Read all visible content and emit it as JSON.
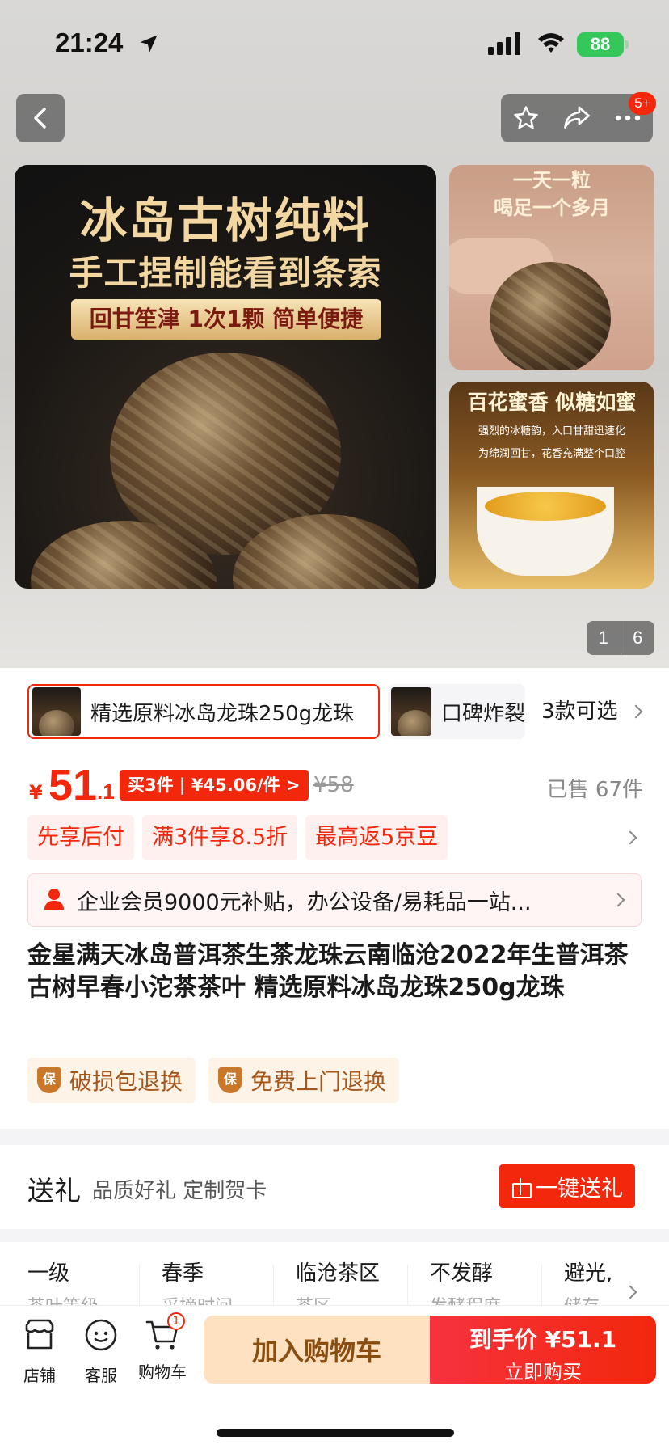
{
  "status_bar": {
    "time": "21:24",
    "battery": "88"
  },
  "header": {
    "badge": "5+"
  },
  "gallery": {
    "main_title": "冰岛古树纯料",
    "main_subtitle": "手工捏制能看到条索",
    "main_tag": "回甘笙津 1次1颗 简单便捷",
    "side1_line1": "一天一粒",
    "side1_line2": "喝足一个多月",
    "side2_title": "百花蜜香 似糖如蜜",
    "side2_line1": "强烈的冰糖韵，入口甘甜迅速化",
    "side2_line2": "为绵润回甘，花香充满整个口腔",
    "pager_current": "1",
    "pager_total": "6"
  },
  "variants": {
    "selected": "精选原料冰岛龙珠250g龙珠",
    "second": "口碑炸裂",
    "more": "3款可选"
  },
  "price": {
    "currency": "¥",
    "integer": "51",
    "decimal": ".1",
    "multi_buy": "买3件 | ¥45.06/件 >",
    "original": "¥58",
    "sold": "已售 67件"
  },
  "promos": [
    "先享后付",
    "满3件享8.5折",
    "最高返5京豆"
  ],
  "member_bar": {
    "text": "企业会员9000元补贴，办公设备/易耗品一站..."
  },
  "product_title": "金星满天冰岛普洱茶生茶龙珠云南临沧2022年生普洱茶古树早春小沱茶茶叶 精选原料冰岛龙珠250g龙珠",
  "guarantees": [
    "破损包退换",
    "免费上门退换"
  ],
  "guarantee_icon_text": "保",
  "gift": {
    "title": "送礼",
    "subtitle": "品质好礼 定制贺卡",
    "button": "一键送礼"
  },
  "params": [
    {
      "label": "一级",
      "sub": "茶叶等级"
    },
    {
      "label": "春季",
      "sub": "采摘时间"
    },
    {
      "label": "临沧茶区",
      "sub": "茶区"
    },
    {
      "label": "不发酵",
      "sub": "发酵程度"
    },
    {
      "label": "避光,",
      "sub": "储存"
    }
  ],
  "bottom_bar": {
    "shop": "店铺",
    "service": "客服",
    "cart": "购物车",
    "cart_count": "1",
    "add_to_cart": "加入购物车",
    "buy_price_label": "到手价 ¥51.1",
    "buy_now": "立即购买"
  },
  "colors": {
    "accent": "#f2270c",
    "cart_bg": "#fde1c0",
    "battery": "#34c759"
  }
}
